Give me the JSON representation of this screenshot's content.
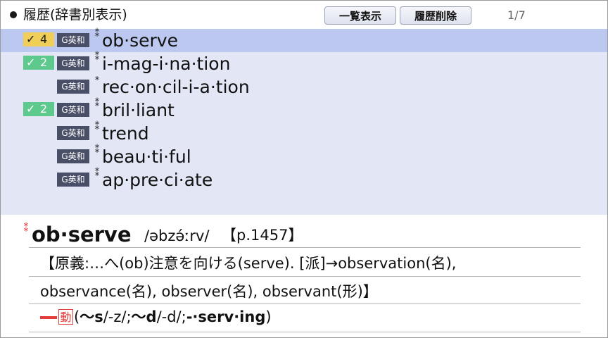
{
  "header": {
    "title": "履歴(辞書別表示)",
    "list_button": "一覧表示",
    "delete_button": "履歴削除",
    "page_count": "1/7"
  },
  "history": [
    {
      "word": "ob·serve",
      "dict": "G英和",
      "star": "⁑",
      "badge": {
        "check": "✓",
        "count": "4",
        "color": "#f1ce57"
      },
      "selected": true
    },
    {
      "word": "i-mag-i·na·tion",
      "dict": "G英和",
      "star": "⁑",
      "badge": {
        "check": "✓",
        "count": "2",
        "color": "#5dc98d"
      },
      "selected": false
    },
    {
      "word": "rec·on·cil-i-a·tion",
      "dict": "G英和",
      "star": "*",
      "badge": null,
      "selected": false
    },
    {
      "word": "bril·liant",
      "dict": "G英和",
      "star": "⁑",
      "badge": {
        "check": "✓",
        "count": "2",
        "color": "#5dc98d"
      },
      "selected": false
    },
    {
      "word": "trend",
      "dict": "G英和",
      "star": "⁑",
      "badge": null,
      "selected": false
    },
    {
      "word": "beau·ti·ful",
      "dict": "G英和",
      "star": "⁑",
      "badge": null,
      "selected": false
    },
    {
      "word": "ap·pre·ci·ate",
      "dict": "G英和",
      "star": "⁑",
      "badge": null,
      "selected": false
    }
  ],
  "entry": {
    "star": "⁑",
    "headword": "ob·serve",
    "pronunciation": "/əbzə́ːrv/",
    "page_ref": "【p.1457】",
    "etymology_line1": "【原義:…へ(ob)注意を向ける(serve). [派]→observation(名),",
    "etymology_line2": "observance(名), observer(名), observant(形)】",
    "pos_label": "動",
    "inflection_open": "(",
    "infl_s": "〜s",
    "infl_s_pron": "/-z/;",
    "infl_d": "〜d",
    "infl_d_pron": "/-d/;",
    "infl_ing": "-·serv·ing",
    "inflection_close": ")"
  }
}
